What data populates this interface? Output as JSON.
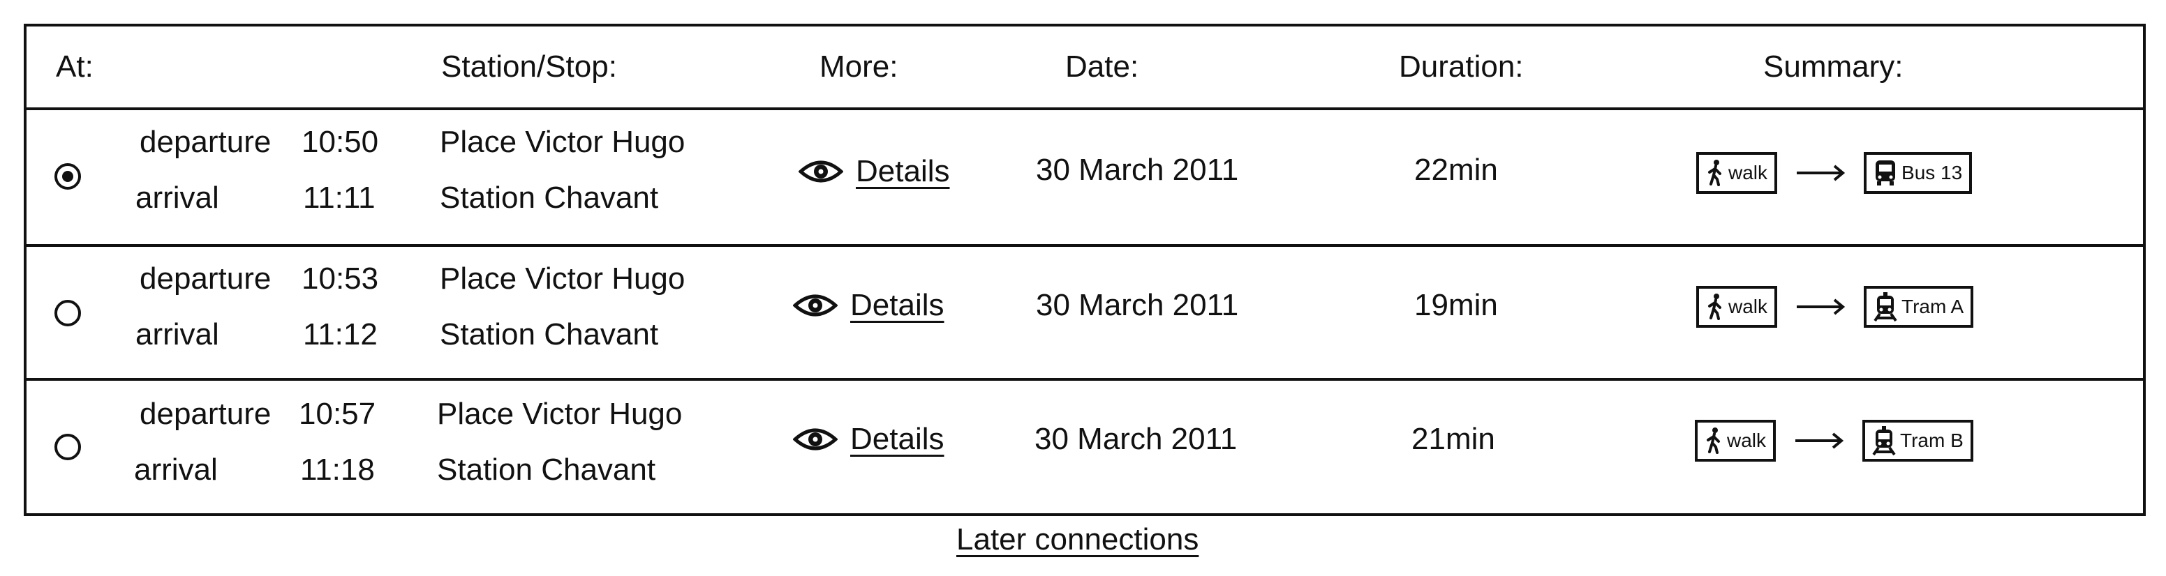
{
  "headers": {
    "at": "At:",
    "station": "Station/Stop:",
    "more": "More:",
    "date": "Date:",
    "duration": "Duration:",
    "summary": "Summary:"
  },
  "rows": [
    {
      "selected": true,
      "departure_label": "departure",
      "departure_time": "10:50",
      "arrival_label": "arrival",
      "arrival_time": "11:11",
      "from_stop": "Place Victor Hugo",
      "to_stop": "Station Chavant",
      "details_label": "Details",
      "date": "30 March 2011",
      "duration": "22min",
      "summary": {
        "walk_label": "walk",
        "vehicle_label": "Bus 13",
        "vehicle_icon": "bus-icon"
      }
    },
    {
      "selected": false,
      "departure_label": "departure",
      "departure_time": "10:53",
      "arrival_label": "arrival",
      "arrival_time": "11:12",
      "from_stop": "Place Victor Hugo",
      "to_stop": "Station Chavant",
      "details_label": "Details",
      "date": "30 March 2011",
      "duration": "19min",
      "summary": {
        "walk_label": "walk",
        "vehicle_label": "Tram A",
        "vehicle_icon": "tram-icon"
      }
    },
    {
      "selected": false,
      "departure_label": "departure",
      "departure_time": "10:57",
      "arrival_label": "arrival",
      "arrival_time": "11:18",
      "from_stop": "Place Victor Hugo",
      "to_stop": "Station Chavant",
      "details_label": "Details",
      "date": "30 March 2011",
      "duration": "21min",
      "summary": {
        "walk_label": "walk",
        "vehicle_label": "Tram B",
        "vehicle_icon": "tram-icon"
      }
    }
  ],
  "footer": {
    "later_connections": "Later connections"
  }
}
